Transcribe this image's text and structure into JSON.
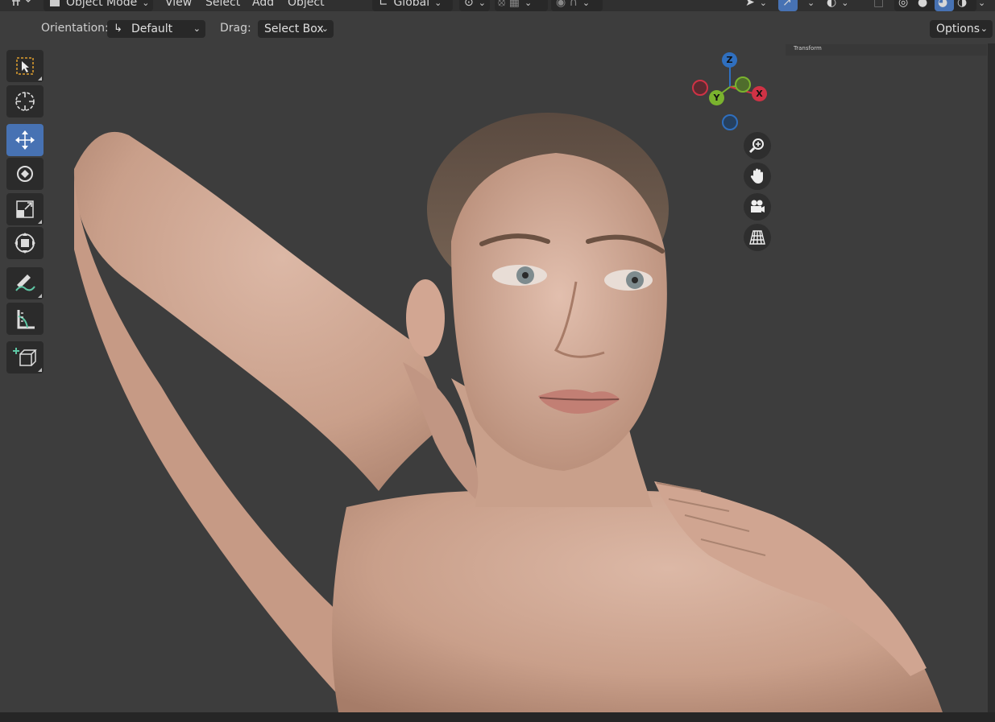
{
  "header": {
    "mode": "Object Mode",
    "menus": [
      "View",
      "Select",
      "Add",
      "Object"
    ],
    "orientation_global": "Global"
  },
  "tool_settings": {
    "orientation_label": "Orientation:",
    "orientation_value": "Default",
    "drag_label": "Drag:",
    "drag_value": "Select Box",
    "options_label": "Options"
  },
  "sidebar": {
    "transform_label": "Transform"
  },
  "gizmo": {
    "z": "Z",
    "y": "Y",
    "x": "X"
  },
  "tools": [
    "select-box",
    "cursor",
    "move",
    "rotate",
    "scale",
    "transform",
    "annotate",
    "measure",
    "add-cube"
  ],
  "nav_buttons": [
    "zoom",
    "pan",
    "camera",
    "perspective-toggle"
  ],
  "colors": {
    "accent": "#4772b3",
    "x_axis": "#d03245",
    "y_axis": "#7ab32e",
    "z_axis": "#2f6fbf"
  }
}
